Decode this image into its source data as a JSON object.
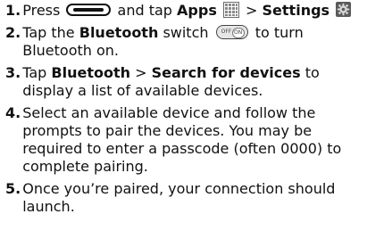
{
  "steps": [
    {
      "number": "1.",
      "segments": {
        "press": "Press",
        "and_tap": "and tap",
        "apps": "Apps",
        "separator": ">",
        "settings": "Settings"
      },
      "icons": [
        "home-key-icon",
        "apps-grid-icon",
        "settings-gear-icon"
      ]
    },
    {
      "number": "2.",
      "segments": {
        "tap_the": "Tap the",
        "bluetooth": "Bluetooth",
        "switch": "switch",
        "to_turn": "to turn Bluetooth on."
      },
      "switch_icon": {
        "off_label": "OFF",
        "on_label": "ON"
      }
    },
    {
      "number": "3.",
      "segments": {
        "tap": "Tap",
        "bluetooth": "Bluetooth",
        "separator": ">",
        "search": "Search for devices",
        "rest": "to display a list of available devices."
      }
    },
    {
      "number": "4.",
      "text": "Select an available device and follow the prompts to pair the devices. You may be required to enter a passcode (often 0000) to complete pairing."
    },
    {
      "number": "5.",
      "text": "Once you’re paired, your connection should launch."
    }
  ]
}
